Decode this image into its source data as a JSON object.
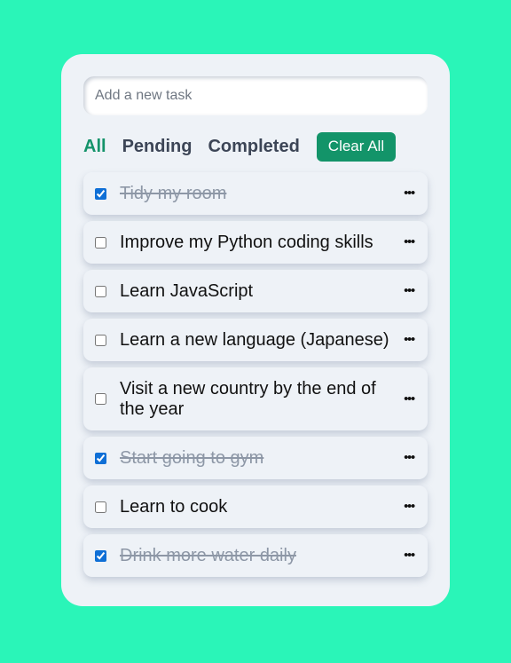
{
  "input": {
    "placeholder": "Add a new task",
    "value": ""
  },
  "filters": {
    "all": "All",
    "pending": "Pending",
    "completed": "Completed",
    "clear_all": "Clear All"
  },
  "tasks": [
    {
      "text": "Tidy my room",
      "done": true
    },
    {
      "text": "Improve my Python coding skills",
      "done": false
    },
    {
      "text": "Learn JavaScript",
      "done": false
    },
    {
      "text": "Learn a new language (Japanese)",
      "done": false
    },
    {
      "text": "Visit a new country by the end of the year",
      "done": false
    },
    {
      "text": "Start going to gym",
      "done": true
    },
    {
      "text": "Learn to cook",
      "done": false
    },
    {
      "text": "Drink more water daily",
      "done": true
    }
  ],
  "menu_glyph": "•••",
  "colors": {
    "background": "#2af5b8",
    "card": "#eef2f7",
    "accent": "#139469",
    "active_filter": "#14936a"
  }
}
